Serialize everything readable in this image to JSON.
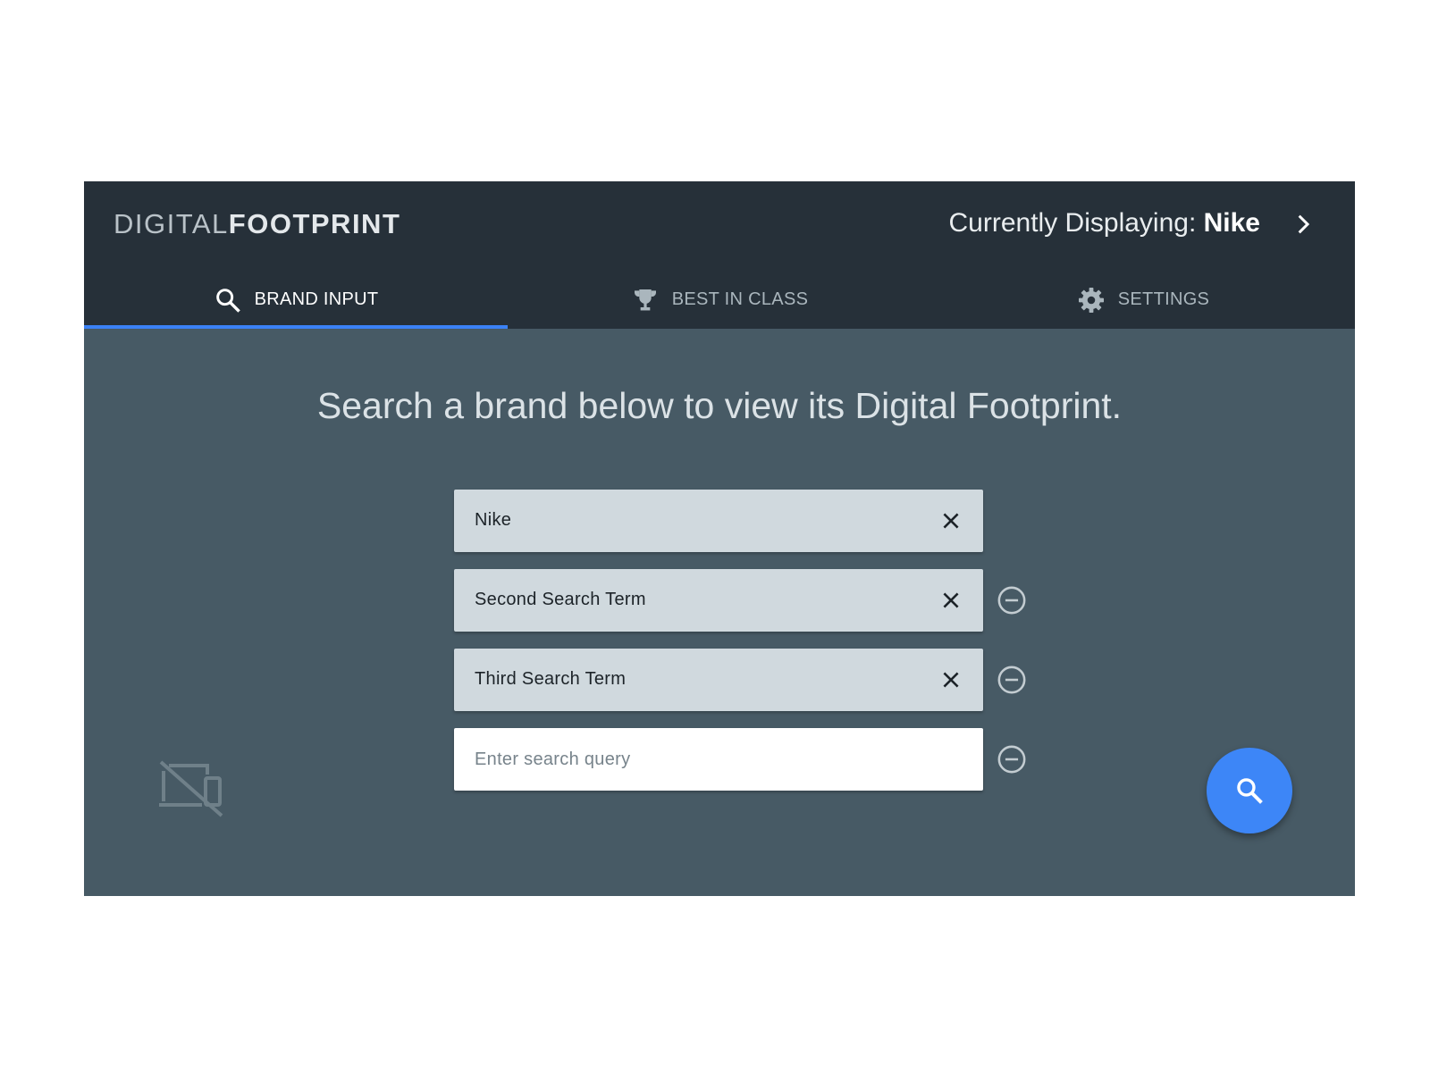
{
  "header": {
    "brand_light": "DIGITAL",
    "brand_bold": "FOOTPRINT",
    "current_label": "Currently Displaying: ",
    "current_value": "Nike",
    "next_icon": "chevron-right-icon"
  },
  "tabs": [
    {
      "label": "BRAND INPUT",
      "icon": "search-icon",
      "active": true
    },
    {
      "label": "BEST IN CLASS",
      "icon": "trophy-icon",
      "active": false
    },
    {
      "label": "SETTINGS",
      "icon": "gear-icon",
      "active": false
    }
  ],
  "main": {
    "headline": "Search a brand below to view its Digital Footprint.",
    "terms": [
      {
        "value": "Nike"
      },
      {
        "value": "Second Search Term"
      },
      {
        "value": "Third Search Term"
      }
    ],
    "query_input": {
      "value": "",
      "placeholder": "Enter search query"
    }
  },
  "colors": {
    "topbar": "#263039",
    "panel": "#475a65",
    "accent": "#3b82f6",
    "chip": "#d0d9de"
  }
}
